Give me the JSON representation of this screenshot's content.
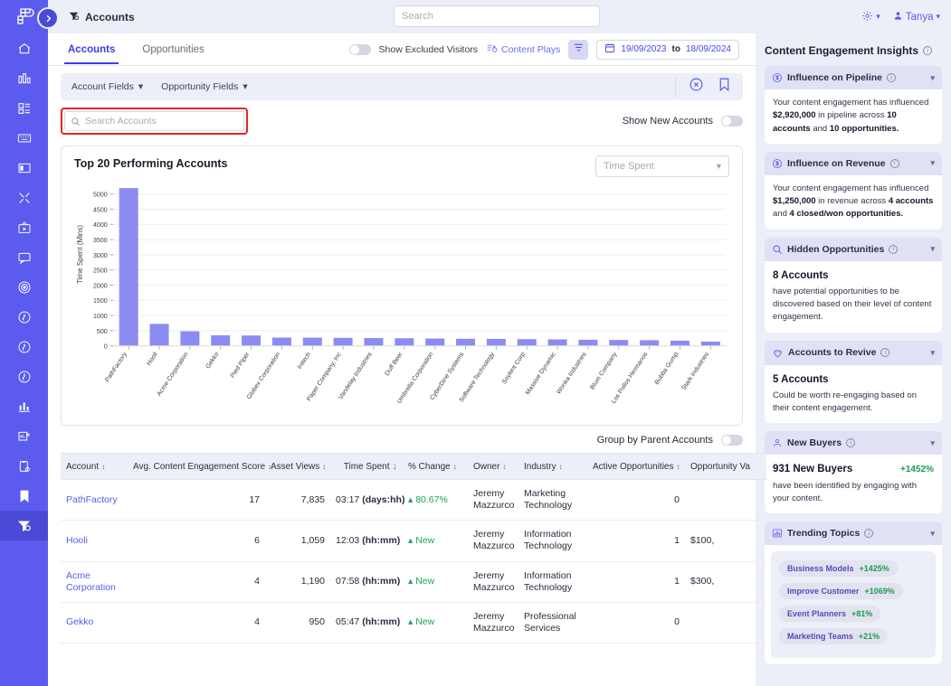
{
  "rail": {
    "logo_icon": "pathfactory-logo-icon",
    "expand_icon": "chevron-right-icon",
    "items": [
      {
        "name": "home",
        "icon": "home-icon"
      },
      {
        "name": "analytics",
        "icon": "bar-chart-icon"
      },
      {
        "name": "content-library",
        "icon": "grid-list-icon"
      },
      {
        "name": "campaigns",
        "icon": "keyboard-icon"
      },
      {
        "name": "pages",
        "icon": "layout-icon"
      },
      {
        "name": "tools",
        "icon": "tools-icon"
      },
      {
        "name": "media",
        "icon": "tv-play-icon"
      },
      {
        "name": "chat",
        "icon": "chat-icon"
      },
      {
        "name": "targeting",
        "icon": "target-icon"
      },
      {
        "name": "tracks-1",
        "icon": "circle-hand-icon"
      },
      {
        "name": "tracks-2",
        "icon": "circle-hand-icon"
      },
      {
        "name": "tracks-3",
        "icon": "circle-hand-icon"
      },
      {
        "name": "reports",
        "icon": "column-chart-icon"
      },
      {
        "name": "add-report",
        "icon": "chart-plus-icon"
      },
      {
        "name": "clipboard",
        "icon": "clipboard-gear-icon"
      },
      {
        "name": "bookmarks",
        "icon": "bookmark-icon"
      },
      {
        "name": "accounts",
        "icon": "funnel-accounts-icon",
        "active": true
      }
    ]
  },
  "topbar": {
    "title": "Accounts",
    "title_icon": "funnel-accounts-icon",
    "search_placeholder": "Search",
    "search_value": "",
    "settings_icon": "gear-icon",
    "user_icon": "user-icon",
    "user_name": "Tanya",
    "chevron": "⌄"
  },
  "tabs": [
    {
      "label": "Accounts",
      "active": true
    },
    {
      "label": "Opportunities",
      "active": false
    }
  ],
  "toolbar": {
    "show_excluded_label": "Show Excluded Visitors",
    "show_excluded_on": false,
    "content_plays_label": "Content Plays",
    "content_plays_icon": "content-plays-icon",
    "filter_icon": "filter-icon",
    "calendar_icon": "calendar-icon",
    "date_from": "19/09/2023",
    "date_to_word": "to",
    "date_to": "18/09/2024"
  },
  "fieldsbar": {
    "account_fields": "Account Fields",
    "opportunity_fields": "Opportunity Fields",
    "clear_icon": "clear-circle-x-icon",
    "bookmark_icon": "bookmark-icon",
    "chevron": "⌄"
  },
  "searchrow": {
    "search_icon": "search-icon",
    "placeholder": "Search Accounts",
    "value": "",
    "show_new_accounts_label": "Show New Accounts",
    "show_new_accounts_on": false
  },
  "chart_card": {
    "title": "Top 20 Performing Accounts",
    "select_value": "Time Spent",
    "select_chevron": "⌄"
  },
  "chart_data": {
    "type": "bar",
    "title": "Top 20 Performing Accounts",
    "xlabel": "",
    "ylabel": "Time Spent (Mins)",
    "ylim": [
      0,
      5200
    ],
    "yticks": [
      0,
      500,
      1000,
      1500,
      2000,
      2500,
      3000,
      3500,
      4000,
      4500,
      5000
    ],
    "grid": true,
    "bar_color": "#8b8bf2",
    "categories": [
      "PathFactory",
      "Hooli",
      "Acme Corporation",
      "Gekko",
      "Pied Piper",
      "Globex Corporation",
      "Initech",
      "Paper Company, Inc",
      "Vandelay Industries",
      "Duff Beer",
      "Umbrella Corporation",
      "CyberDine Systems",
      "Software Technology",
      "Soylent Corp",
      "Massive Dynamic",
      "Wonka Industries",
      "Blum Company",
      "Los Pollos Hermanos",
      "Bubba Gump",
      "Stark Industries"
    ],
    "values": [
      5197,
      723,
      478,
      347,
      340,
      272,
      268,
      262,
      255,
      250,
      240,
      232,
      228,
      220,
      212,
      200,
      192,
      185,
      170,
      140
    ]
  },
  "groupby": {
    "label": "Group by Parent Accounts",
    "on": false
  },
  "table": {
    "columns": [
      {
        "label": "Account",
        "sortable": true,
        "align": "left"
      },
      {
        "label": "Avg. Content Engagement Score",
        "sortable": true,
        "align": "right"
      },
      {
        "label": "Asset Views",
        "sortable": true,
        "align": "right"
      },
      {
        "label": "Time Spent",
        "sortable": true,
        "sorted": "desc",
        "align": "right"
      },
      {
        "label": "% Change",
        "sortable": true,
        "align": "left"
      },
      {
        "label": "Owner",
        "sortable": true,
        "align": "left"
      },
      {
        "label": "Industry",
        "sortable": true,
        "align": "left"
      },
      {
        "label": "Active Opportunities",
        "sortable": true,
        "align": "right"
      },
      {
        "label": "Opportunity Va",
        "sortable": false,
        "align": "left"
      }
    ],
    "rows": [
      {
        "account": "PathFactory",
        "score": "17",
        "asset_views": "7,835",
        "time_spent": "03:17",
        "time_unit": "(days:hh)",
        "change": "80.67%",
        "change_dir": "up",
        "owner": "Jeremy Mazzurco",
        "industry": "Marketing Technology",
        "active_opps": "0",
        "opp_value": ""
      },
      {
        "account": "Hooli",
        "score": "6",
        "asset_views": "1,059",
        "time_spent": "12:03",
        "time_unit": "(hh:mm)",
        "change": "New",
        "change_dir": "up",
        "owner": "Jeremy Mazzurco",
        "industry": "Information Technology",
        "active_opps": "1",
        "opp_value": "$100,"
      },
      {
        "account": "Acme Corporation",
        "score": "4",
        "asset_views": "1,190",
        "time_spent": "07:58",
        "time_unit": "(hh:mm)",
        "change": "New",
        "change_dir": "up",
        "owner": "Jeremy Mazzurco",
        "industry": "Information Technology",
        "active_opps": "1",
        "opp_value": "$300,"
      },
      {
        "account": "Gekko",
        "score": "4",
        "asset_views": "950",
        "time_spent": "05:47",
        "time_unit": "(hh:mm)",
        "change": "New",
        "change_dir": "up",
        "owner": "Jeremy Mazzurco",
        "industry": "Professional Services",
        "active_opps": "0",
        "opp_value": ""
      }
    ]
  },
  "insights": {
    "title": "Content Engagement Insights",
    "cards": [
      {
        "key": "pipeline",
        "icon": "dollar-circle-icon",
        "title": "Influence on Pipeline",
        "line1": "Your content engagement has influenced",
        "v1": "$2,920,000",
        "mid1": " in pipeline across ",
        "v2": "10 accounts",
        "mid2": " and ",
        "v3": "10 opportunities."
      },
      {
        "key": "revenue",
        "icon": "dollar-circle-icon",
        "title": "Influence on Revenue",
        "line1": "Your content engagement has influenced",
        "v1": "$1,250,000",
        "mid1": " in revenue across ",
        "v2": "4 accounts",
        "mid2": " and ",
        "v3": "4 closed/won opportunities."
      },
      {
        "key": "hidden",
        "icon": "search-icon",
        "title": "Hidden Opportunities",
        "big": "8 Accounts",
        "body": "have potential opportunities to be discovered based on their level of content engagement."
      },
      {
        "key": "revive",
        "icon": "heart-icon",
        "title": "Accounts to Revive",
        "big": "5 Accounts",
        "body": "Could be worth re-engaging based on their content engagement."
      },
      {
        "key": "buyers",
        "icon": "user-icon",
        "title": "New Buyers",
        "big": "931 New Buyers",
        "pct": "+1452%",
        "body": "have been identified by engaging with your content."
      },
      {
        "key": "topics",
        "icon": "bar-chart-icon",
        "title": "Trending Topics"
      }
    ],
    "topics": [
      {
        "name": "Business Models",
        "pct": "+1425%"
      },
      {
        "name": "Improve Customer",
        "pct": "+1069%"
      },
      {
        "name": "Event Planners",
        "pct": "+81%"
      },
      {
        "name": "Marketing Teams",
        "pct": "+21%"
      }
    ],
    "chevron": "⌄",
    "info_glyph": "i"
  },
  "colors": {
    "brand": "#5b5bf0",
    "rail": "#5b5bf0",
    "panel_bg": "#eceef8",
    "bar": "#8b8bf2",
    "green": "#21a05a",
    "highlight_border": "#ee2222"
  }
}
